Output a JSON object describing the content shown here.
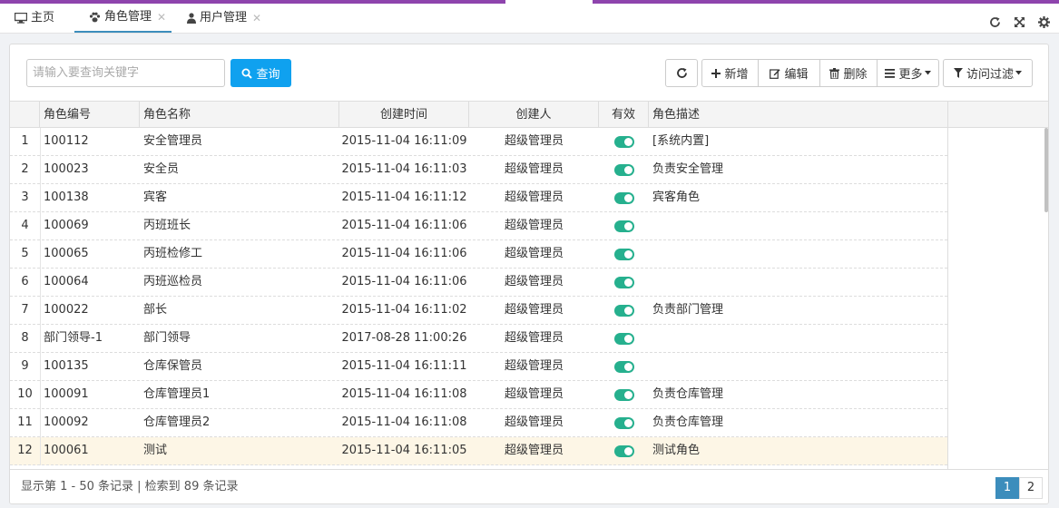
{
  "tabs": [
    {
      "label": "主页",
      "icon": "monitor-icon"
    },
    {
      "label": "角色管理",
      "icon": "paw-icon",
      "close": "✕"
    },
    {
      "label": "用户管理",
      "icon": "user-icon",
      "close": "✕"
    }
  ],
  "toolbar": {
    "search_placeholder": "请输入要查询关键字",
    "query_label": "查询",
    "add_label": "新增",
    "edit_label": "编辑",
    "delete_label": "删除",
    "more_label": "更多",
    "filter_label": "访问过滤"
  },
  "columns": [
    "角色编号",
    "角色名称",
    "创建时间",
    "创建人",
    "有效",
    "角色描述"
  ],
  "rows": [
    {
      "n": "1",
      "code": "100112",
      "name": "安全管理员",
      "time": "2015-11-04 16:11:09",
      "creator": "超级管理员",
      "desc": "[系统内置]"
    },
    {
      "n": "2",
      "code": "100023",
      "name": "安全员",
      "time": "2015-11-04 16:11:03",
      "creator": "超级管理员",
      "desc": "负责安全管理"
    },
    {
      "n": "3",
      "code": "100138",
      "name": "宾客",
      "time": "2015-11-04 16:11:12",
      "creator": "超级管理员",
      "desc": "宾客角色"
    },
    {
      "n": "4",
      "code": "100069",
      "name": "丙班班长",
      "time": "2015-11-04 16:11:06",
      "creator": "超级管理员",
      "desc": ""
    },
    {
      "n": "5",
      "code": "100065",
      "name": "丙班检修工",
      "time": "2015-11-04 16:11:06",
      "creator": "超级管理员",
      "desc": ""
    },
    {
      "n": "6",
      "code": "100064",
      "name": "丙班巡检员",
      "time": "2015-11-04 16:11:06",
      "creator": "超级管理员",
      "desc": ""
    },
    {
      "n": "7",
      "code": "100022",
      "name": "部长",
      "time": "2015-11-04 16:11:02",
      "creator": "超级管理员",
      "desc": "负责部门管理"
    },
    {
      "n": "8",
      "code": "部门领导-1",
      "name": "部门领导",
      "time": "2017-08-28 11:00:26",
      "creator": "超级管理员",
      "desc": ""
    },
    {
      "n": "9",
      "code": "100135",
      "name": "仓库保管员",
      "time": "2015-11-04 16:11:11",
      "creator": "超级管理员",
      "desc": ""
    },
    {
      "n": "10",
      "code": "100091",
      "name": "仓库管理员1",
      "time": "2015-11-04 16:11:08",
      "creator": "超级管理员",
      "desc": "负责仓库管理"
    },
    {
      "n": "11",
      "code": "100092",
      "name": "仓库管理员2",
      "time": "2015-11-04 16:11:08",
      "creator": "超级管理员",
      "desc": "负责仓库管理"
    },
    {
      "n": "12",
      "code": "100061",
      "name": "测试",
      "time": "2015-11-04 16:11:05",
      "creator": "超级管理员",
      "desc": "测试角色"
    }
  ],
  "footer": {
    "info": "显示第 1 - 50 条记录 | 检索到 89 条记录",
    "pages": [
      "1",
      "2"
    ]
  },
  "colors": {
    "accent": "#3c8dbc",
    "query_button": "#0fa1ef",
    "toggle_on": "#26b08e",
    "top_line": "#8e44ad"
  }
}
